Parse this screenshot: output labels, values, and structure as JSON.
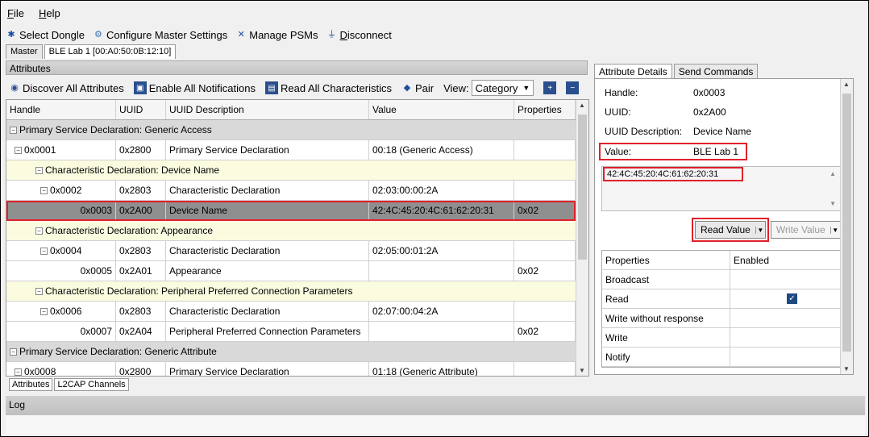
{
  "menu": {
    "file": "File",
    "help": "Help"
  },
  "toolbar": {
    "select_dongle": "Select Dongle",
    "configure": "Configure Master Settings",
    "manage_psms": "Manage PSMs",
    "disconnect": "Disconnect"
  },
  "tabs": {
    "master": "Master",
    "device": "BLE Lab 1 [00:A0:50:0B:12:10]"
  },
  "attributes": {
    "header": "Attributes",
    "discover": "Discover All Attributes",
    "enable_notif": "Enable All Notifications",
    "read_all": "Read All Characteristics",
    "pair": "Pair",
    "view_label": "View:",
    "view_value": "Category",
    "columns": [
      "Handle",
      "UUID",
      "UUID Description",
      "Value",
      "Properties"
    ],
    "rows": [
      {
        "type": "svc",
        "label": "Primary Service Declaration: Generic Access"
      },
      {
        "handle": "0x0001",
        "uuid": "0x2800",
        "desc": "Primary Service Declaration",
        "value": "00:18 (Generic Access)",
        "props": ""
      },
      {
        "type": "chr",
        "label": "Characteristic Declaration: Device Name"
      },
      {
        "handle": "0x0002",
        "uuid": "0x2803",
        "desc": "Characteristic Declaration",
        "value": "02:03:00:00:2A",
        "props": ""
      },
      {
        "handle": "0x0003",
        "uuid": "0x2A00",
        "desc": "Device Name",
        "value": "42:4C:45:20:4C:61:62:20:31",
        "props": "0x02"
      },
      {
        "type": "chr",
        "label": "Characteristic Declaration: Appearance"
      },
      {
        "handle": "0x0004",
        "uuid": "0x2803",
        "desc": "Characteristic Declaration",
        "value": "02:05:00:01:2A",
        "props": ""
      },
      {
        "handle": "0x0005",
        "uuid": "0x2A01",
        "desc": "Appearance",
        "value": "",
        "props": "0x02"
      },
      {
        "type": "chr",
        "label": "Characteristic Declaration: Peripheral Preferred Connection Parameters"
      },
      {
        "handle": "0x0006",
        "uuid": "0x2803",
        "desc": "Characteristic Declaration",
        "value": "02:07:00:04:2A",
        "props": ""
      },
      {
        "handle": "0x0007",
        "uuid": "0x2A04",
        "desc": "Peripheral Preferred Connection Parameters",
        "value": "",
        "props": "0x02"
      },
      {
        "type": "svc",
        "label": "Primary Service Declaration: Generic Attribute"
      },
      {
        "handle": "0x0008",
        "uuid": "0x2800",
        "desc": "Primary Service Declaration",
        "value": "01:18 (Generic Attribute)",
        "props": ""
      }
    ]
  },
  "bottom_tabs": {
    "attributes": "Attributes",
    "l2cap": "L2CAP Channels"
  },
  "details": {
    "tab_details": "Attribute Details",
    "tab_send": "Send Commands",
    "handle_k": "Handle:",
    "handle_v": "0x0003",
    "uuid_k": "UUID:",
    "uuid_v": "0x2A00",
    "desc_k": "UUID Description:",
    "desc_v": "Device Name",
    "value_k": "Value:",
    "value_v": "BLE Lab 1",
    "hex": "42:4C:45:20:4C:61:62:20:31",
    "read_value": "Read Value",
    "write_value": "Write Value",
    "prop_header": "Properties",
    "enabled_header": "Enabled",
    "props": [
      "Broadcast",
      "Read",
      "Write without response",
      "Write",
      "Notify"
    ]
  },
  "log": {
    "label": "Log"
  }
}
